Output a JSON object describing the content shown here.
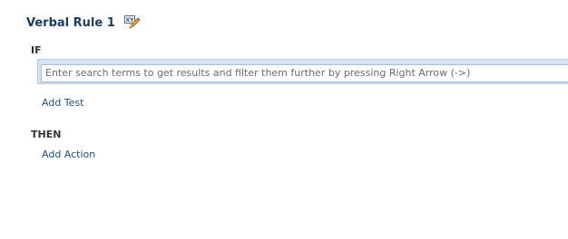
{
  "rule": {
    "title": "Verbal Rule 1",
    "edit_icon": "edit-pencil-icon"
  },
  "if_section": {
    "label": "IF",
    "search": {
      "value": "",
      "placeholder": "Enter search terms to get results and filter them further by pressing Right Arrow (->)"
    },
    "add_test_label": "Add Test"
  },
  "then_section": {
    "label": "THEN",
    "add_action_label": "Add Action"
  },
  "colors": {
    "title": "#1c3e63",
    "link": "#1f4f82",
    "search_frame": "#d6e3f0"
  }
}
